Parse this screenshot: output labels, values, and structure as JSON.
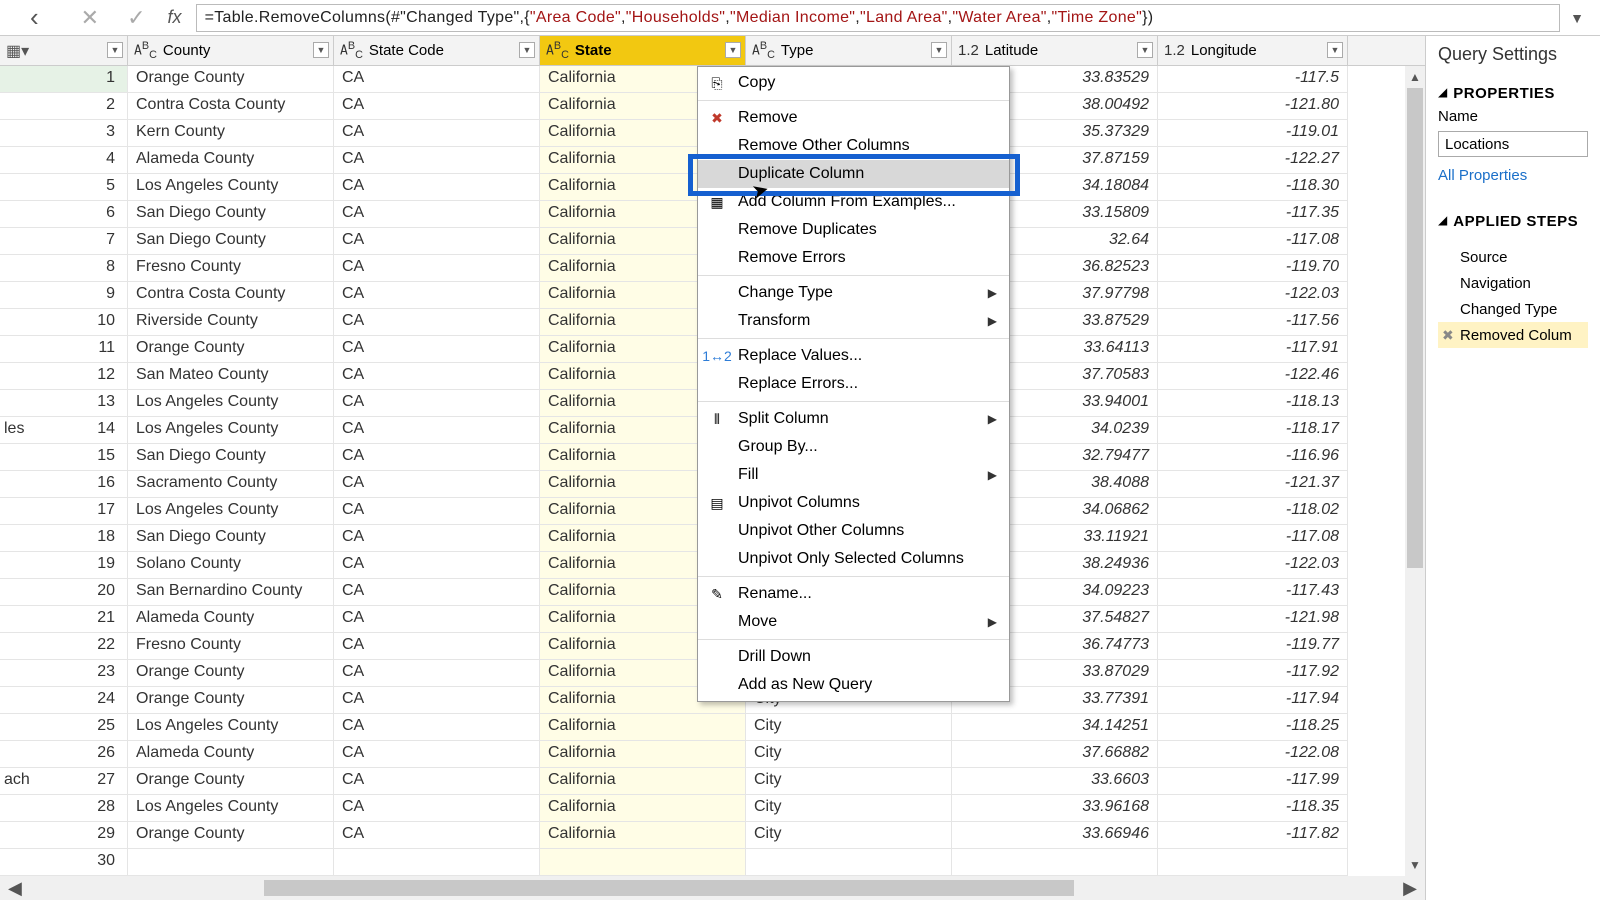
{
  "formula": {
    "eq": "= ",
    "p1": "Table.RemoveColumns(",
    "ref": "#\"Changed Type\"",
    "p2": ",{",
    "s1": "\"Area Code\"",
    "c": ", ",
    "s2": "\"Households\"",
    "s3": "\"Median Income\"",
    "s4": "\"Land Area\"",
    "s5": "\"Water Area\"",
    "s6": "\"Time Zone\"",
    "p3": "})"
  },
  "headers": {
    "county": "County",
    "code": "State Code",
    "state": "State",
    "type": "Type",
    "lat": "Latitude",
    "lon": "Longitude",
    "abc": "ABC",
    "num": "1.2"
  },
  "rows": [
    {
      "n": "1",
      "of": "",
      "county": "Orange County",
      "code": "CA",
      "state": "California",
      "type": "",
      "lat": "33.83529",
      "lon": "-117.5"
    },
    {
      "n": "2",
      "of": "",
      "county": "Contra Costa County",
      "code": "CA",
      "state": "California",
      "type": "",
      "lat": "38.00492",
      "lon": "-121.80"
    },
    {
      "n": "3",
      "of": "",
      "county": "Kern County",
      "code": "CA",
      "state": "California",
      "type": "",
      "lat": "35.37329",
      "lon": "-119.01"
    },
    {
      "n": "4",
      "of": "",
      "county": "Alameda County",
      "code": "CA",
      "state": "California",
      "type": "",
      "lat": "37.87159",
      "lon": "-122.27"
    },
    {
      "n": "5",
      "of": "",
      "county": "Los Angeles County",
      "code": "CA",
      "state": "California",
      "type": "",
      "lat": "34.18084",
      "lon": "-118.30"
    },
    {
      "n": "6",
      "of": "",
      "county": "San Diego County",
      "code": "CA",
      "state": "California",
      "type": "",
      "lat": "33.15809",
      "lon": "-117.35"
    },
    {
      "n": "7",
      "of": "",
      "county": "San Diego County",
      "code": "CA",
      "state": "California",
      "type": "",
      "lat": "32.64",
      "lon": "-117.08"
    },
    {
      "n": "8",
      "of": "",
      "county": "Fresno County",
      "code": "CA",
      "state": "California",
      "type": "",
      "lat": "36.82523",
      "lon": "-119.70"
    },
    {
      "n": "9",
      "of": "",
      "county": "Contra Costa County",
      "code": "CA",
      "state": "California",
      "type": "",
      "lat": "37.97798",
      "lon": "-122.03"
    },
    {
      "n": "10",
      "of": "",
      "county": "Riverside County",
      "code": "CA",
      "state": "California",
      "type": "",
      "lat": "33.87529",
      "lon": "-117.56"
    },
    {
      "n": "11",
      "of": "",
      "county": "Orange County",
      "code": "CA",
      "state": "California",
      "type": "",
      "lat": "33.64113",
      "lon": "-117.91"
    },
    {
      "n": "12",
      "of": "",
      "county": "San Mateo County",
      "code": "CA",
      "state": "California",
      "type": "",
      "lat": "37.70583",
      "lon": "-122.46"
    },
    {
      "n": "13",
      "of": "",
      "county": "Los Angeles County",
      "code": "CA",
      "state": "California",
      "type": "",
      "lat": "33.94001",
      "lon": "-118.13"
    },
    {
      "n": "14",
      "of": "les",
      "county": "Los Angeles County",
      "code": "CA",
      "state": "California",
      "type": "",
      "lat": "34.0239",
      "lon": "-118.17"
    },
    {
      "n": "15",
      "of": "",
      "county": "San Diego County",
      "code": "CA",
      "state": "California",
      "type": "",
      "lat": "32.79477",
      "lon": "-116.96"
    },
    {
      "n": "16",
      "of": "",
      "county": "Sacramento County",
      "code": "CA",
      "state": "California",
      "type": "",
      "lat": "38.4088",
      "lon": "-121.37"
    },
    {
      "n": "17",
      "of": "",
      "county": "Los Angeles County",
      "code": "CA",
      "state": "California",
      "type": "",
      "lat": "34.06862",
      "lon": "-118.02"
    },
    {
      "n": "18",
      "of": "",
      "county": "San Diego County",
      "code": "CA",
      "state": "California",
      "type": "",
      "lat": "33.11921",
      "lon": "-117.08"
    },
    {
      "n": "19",
      "of": "",
      "county": "Solano County",
      "code": "CA",
      "state": "California",
      "type": "",
      "lat": "38.24936",
      "lon": "-122.03"
    },
    {
      "n": "20",
      "of": "",
      "county": "San Bernardino County",
      "code": "CA",
      "state": "California",
      "type": "",
      "lat": "34.09223",
      "lon": "-117.43"
    },
    {
      "n": "21",
      "of": "",
      "county": "Alameda County",
      "code": "CA",
      "state": "California",
      "type": "",
      "lat": "37.54827",
      "lon": "-121.98"
    },
    {
      "n": "22",
      "of": "",
      "county": "Fresno County",
      "code": "CA",
      "state": "California",
      "type": "",
      "lat": "36.74773",
      "lon": "-119.77"
    },
    {
      "n": "23",
      "of": "",
      "county": "Orange County",
      "code": "CA",
      "state": "California",
      "type": "",
      "lat": "33.87029",
      "lon": "-117.92"
    },
    {
      "n": "24",
      "of": "",
      "county": "Orange County",
      "code": "CA",
      "state": "California",
      "type": "City",
      "lat": "33.77391",
      "lon": "-117.94"
    },
    {
      "n": "25",
      "of": "",
      "county": "Los Angeles County",
      "code": "CA",
      "state": "California",
      "type": "City",
      "lat": "34.14251",
      "lon": "-118.25"
    },
    {
      "n": "26",
      "of": "",
      "county": "Alameda County",
      "code": "CA",
      "state": "California",
      "type": "City",
      "lat": "37.66882",
      "lon": "-122.08"
    },
    {
      "n": "27",
      "of": "ach",
      "county": "Orange County",
      "code": "CA",
      "state": "California",
      "type": "City",
      "lat": "33.6603",
      "lon": "-117.99"
    },
    {
      "n": "28",
      "of": "",
      "county": "Los Angeles County",
      "code": "CA",
      "state": "California",
      "type": "City",
      "lat": "33.96168",
      "lon": "-118.35"
    },
    {
      "n": "29",
      "of": "",
      "county": "Orange County",
      "code": "CA",
      "state": "California",
      "type": "City",
      "lat": "33.66946",
      "lon": "-117.82"
    },
    {
      "n": "30",
      "of": "",
      "county": "",
      "code": "",
      "state": "",
      "type": "",
      "lat": "",
      "lon": ""
    }
  ],
  "menu": {
    "copy": "Copy",
    "remove": "Remove",
    "removeOther": "Remove Other Columns",
    "duplicate": "Duplicate Column",
    "addExample": "Add Column From Examples...",
    "removeDup": "Remove Duplicates",
    "removeErr": "Remove Errors",
    "changeType": "Change Type",
    "transform": "Transform",
    "replaceVal": "Replace Values...",
    "replaceErr": "Replace Errors...",
    "split": "Split Column",
    "groupBy": "Group By...",
    "fill": "Fill",
    "unpivot": "Unpivot Columns",
    "unpivotOther": "Unpivot Other Columns",
    "unpivotSel": "Unpivot Only Selected Columns",
    "rename": "Rename...",
    "move": "Move",
    "drill": "Drill Down",
    "addQuery": "Add as New Query"
  },
  "settings": {
    "title": "Query Settings",
    "properties": "PROPERTIES",
    "nameLabel": "Name",
    "nameValue": "Locations",
    "allProps": "All Properties",
    "applied": "APPLIED STEPS",
    "steps": [
      "Source",
      "Navigation",
      "Changed Type",
      "Removed Colum"
    ]
  }
}
